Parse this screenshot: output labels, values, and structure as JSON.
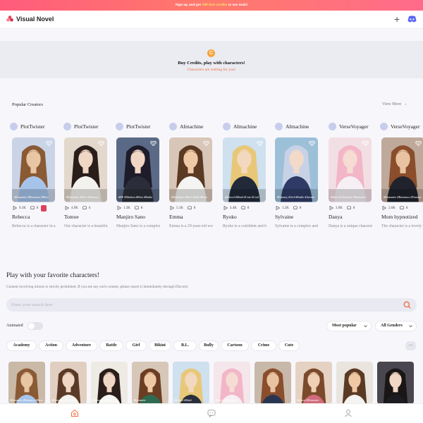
{
  "banner": {
    "pre": "Sign up and get ",
    "highlight": "100 free credits",
    "post": " to use tools!"
  },
  "header": {
    "logo_text": "Visual Novel",
    "plus_label": "+"
  },
  "credits": {
    "title": "Buy Credits, play with characters!",
    "subtitle": "Characters are waiting for you!",
    "coin": "C"
  },
  "popular": {
    "title": "Popular Creators",
    "view_more": "View More"
  },
  "cards": [
    {
      "creator": "PlotTwister",
      "tags": "#Romantic #Romance #Hero",
      "views": "9.1K",
      "chats": "8",
      "name": "Rebecca",
      "desc": "Rebecca is a character in a story",
      "skin": "#e9c6a3",
      "hair": "#8a5a35",
      "bg": "#c9d4e6",
      "cloth": "#a6c4ea",
      "badge": true
    },
    {
      "creator": "PlotTwister",
      "tags": "#Romantic #Hero #Fantasy",
      "views": "4.9K",
      "chats": "6",
      "name": "Tomoe",
      "desc": "Our character is a beautiful girl",
      "skin": "#f0d6c4",
      "hair": "#2a1e1a",
      "bg": "#e2d8cc",
      "cloth": "#f4f2ee"
    },
    {
      "creator": "PlotTwister",
      "tags": "#BF #Modern #Hero #Battle",
      "views": "1.3K",
      "chats": "8",
      "name": "Manjiro Sano",
      "desc": "Manjiro Sano is a complex character",
      "skin": "#f0d6c4",
      "hair": "#1e1c2a",
      "bg": "#5a6a86",
      "cloth": "#2b2e3a"
    },
    {
      "creator": "AImachine",
      "tags": "#Romantic #Hero #Girl #Boss",
      "views": "5.1K",
      "chats": "8",
      "name": "Emma",
      "desc": "Emma is a 29-year-old woman",
      "skin": "#efc8a6",
      "hair": "#5b3a24",
      "bg": "#d8c6b8",
      "cloth": "#f4f4f2"
    },
    {
      "creator": "AImachine",
      "tags": "#School #Maid #Cute #Cool",
      "views": "4.4K",
      "chats": "8",
      "name": "Ryoko",
      "desc": "Ryoko is a confident and bold",
      "skin": "#f3d8c0",
      "hair": "#e8c878",
      "bg": "#cfe0ee",
      "cloth": "#222a3a"
    },
    {
      "creator": "AImachine",
      "tags": "#Fantasy #Girl #Battle #Anime",
      "views": "1.2K",
      "chats": "8",
      "name": "Sylvaine",
      "desc": "Sylvaine is a complex and mysterious",
      "skin": "#f3dac8",
      "hair": "#c8d2e6",
      "bg": "#9cc0d8",
      "cloth": "#2f3b66"
    },
    {
      "creator": "VerseVoyager",
      "tags": "#Hero #Adventure #Romance",
      "views": "3.9K",
      "chats": "8",
      "name": "Danya",
      "desc": "Danya is a unique character",
      "skin": "#f6dcd2",
      "hair": "#f2b6c8",
      "bg": "#f2dfe4",
      "cloth": "#f6f0f4"
    },
    {
      "creator": "VerseVoyager",
      "tags": "#Romantic #Romance #Fantasy",
      "views": "2.6K",
      "chats": "8",
      "name": "Mom hypnotized",
      "desc": "The character is a lovely woman",
      "skin": "#e9c3a1",
      "hair": "#8a4e2c",
      "bg": "#bfa99a",
      "cloth": "#20232c"
    }
  ],
  "play": {
    "title": "Play with your favorite characters!",
    "notice": "Content involving minors is strictly prohibited. If you see any such content, please report it immediately through Discord.",
    "search_placeholder": "Enter your search here",
    "animated_label": "Animated",
    "sort_label": "Most popular",
    "gender_label": "All Genders"
  },
  "chips": [
    "Academy",
    "Action",
    "Adventure",
    "Battle",
    "Girl",
    "Bikini",
    "B.L.",
    "Bully",
    "Cartoon",
    "Crime",
    "Cute"
  ],
  "more_label": "...",
  "grid": [
    {
      "tags": "#Romantic #Romance #Hero",
      "skin": "#e9c6a3",
      "hair": "#8a5a35",
      "bg": "#c9b9a6",
      "cloth": "#a6c4ea"
    },
    {
      "tags": "#Romantic #Romance",
      "skin": "#f0d6c4",
      "hair": "#5a3a26",
      "bg": "#e0cfc0",
      "cloth": "#f4f2ee"
    },
    {
      "tags": "#Romance #Hero",
      "skin": "#f0d6c4",
      "hair": "#2a1e1a",
      "bg": "#eeeae4",
      "cloth": "#f6f6f4"
    },
    {
      "tags": "#Romantic",
      "skin": "#efc8a6",
      "hair": "#6b3e24",
      "bg": "#d7c7b8",
      "cloth": "#2f6a52"
    },
    {
      "tags": "#School #Maid",
      "skin": "#f3d8c0",
      "hair": "#e8c878",
      "bg": "#cfe0ee",
      "cloth": "#2a2e3c"
    },
    {
      "tags": "#Hero #Adventure",
      "skin": "#f6dcd2",
      "hair": "#f2b6c8",
      "bg": "#f4e6ea",
      "cloth": "#f6f0f4"
    },
    {
      "tags": "",
      "skin": "#e9c3a1",
      "hair": "#8a4e2c",
      "bg": "#c8b8aa",
      "cloth": "#2a3552"
    },
    {
      "tags": "#School #Romantic",
      "skin": "#f0cfb4",
      "hair": "#7a4a2a",
      "bg": "#e6d2c2",
      "cloth": "#d06b7a"
    },
    {
      "tags": "",
      "skin": "#efc8a6",
      "hair": "#5b3a24",
      "bg": "#e9e4de",
      "cloth": "#f4f4f2"
    },
    {
      "tags": "",
      "skin": "#f0d6c4",
      "hair": "#1a1616",
      "bg": "#4a4650",
      "cloth": "#1c1c22"
    }
  ],
  "colors": {
    "accent": "#ef6d3d",
    "banner_start": "#ff5c7c",
    "badge": "#e0405b",
    "coin": "#f7a43a"
  }
}
